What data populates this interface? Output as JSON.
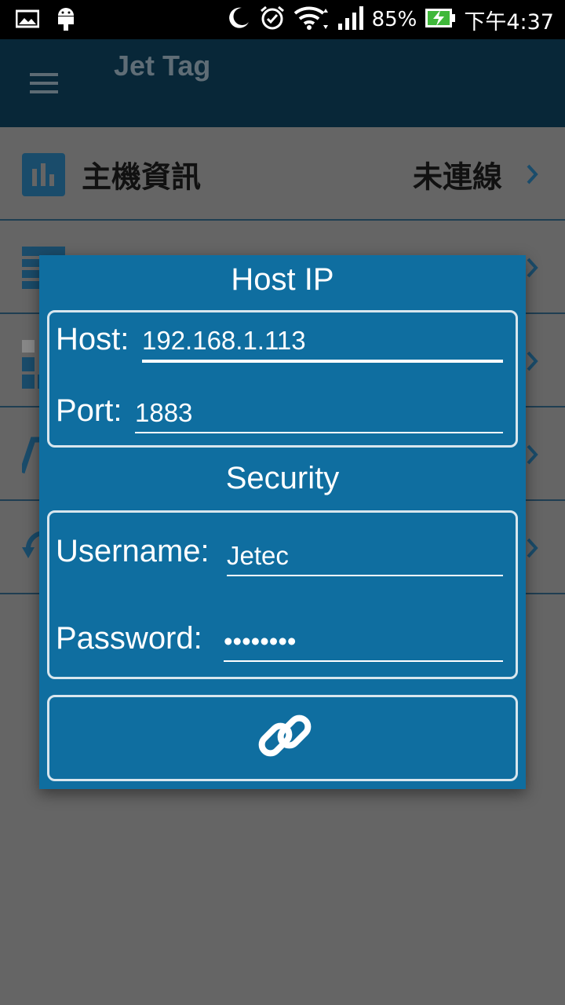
{
  "status_bar": {
    "battery": "85%",
    "time": "下午4:37",
    "icons": [
      "image-icon",
      "android-icon",
      "moon-icon",
      "alarm-icon",
      "wifi-icon",
      "signal-icon",
      "battery-charging-icon"
    ]
  },
  "app_bar": {
    "title": "Jet Tag",
    "menu_icon": "menu-icon"
  },
  "list": {
    "items": [
      {
        "label": "主機資訊",
        "value": "未連線",
        "icon": "bar-chart-icon"
      }
    ]
  },
  "dialog": {
    "host_title": "Host IP",
    "host_label": "Host:",
    "host_value": "192.168.1.113",
    "port_label": "Port:",
    "port_value": "1883",
    "security_title": "Security",
    "username_label": "Username:",
    "username_value": "Jetec",
    "password_label": "Password:",
    "password_value": "••••••••",
    "connect_icon": "link-icon"
  },
  "colors": {
    "dialog_bg": "#0f6ea0",
    "app_bar_dimmed": "#082738",
    "overlay": "#656565",
    "icon_blue": "#1a4c6b"
  }
}
